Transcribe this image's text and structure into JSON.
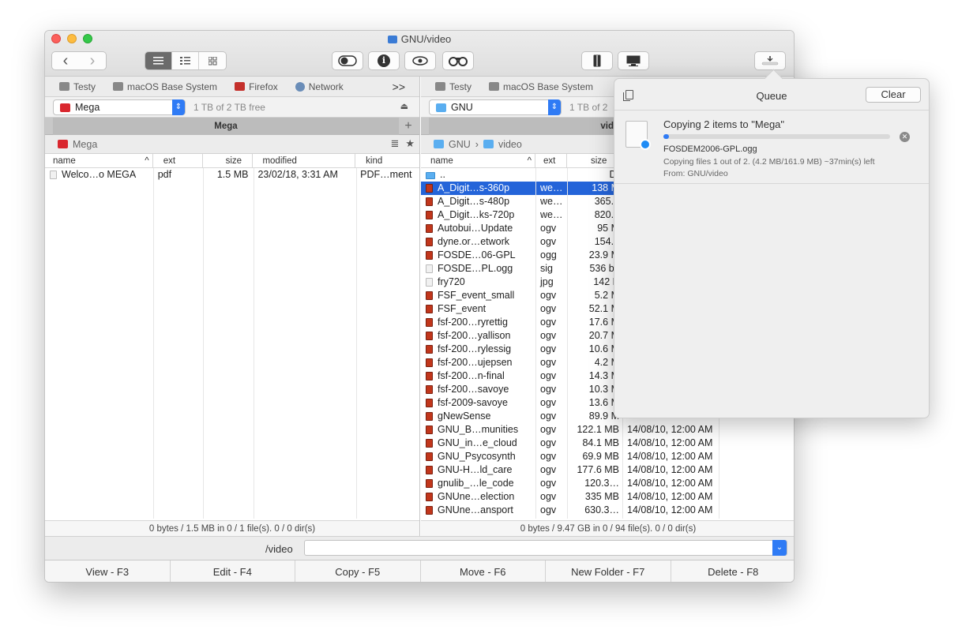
{
  "window": {
    "title": "GNU/video",
    "colors": {
      "selection": "#2464d9",
      "accent": "#2f7bf5"
    }
  },
  "toolbar": {
    "back_icon": "‹",
    "forward_icon": "›",
    "views": [
      "list-view-icon",
      "detail-view-icon",
      "grid-view-icon"
    ],
    "toggle_icon": "toggle-icon",
    "info_icon": "i",
    "preview_icon": "eye-icon",
    "search_icon": "binoculars-icon",
    "archive_icon": "archive-icon",
    "network_icon": "monitor-icon",
    "queue_icon": "download-queue-icon"
  },
  "left": {
    "bookmarks": [
      "Testy",
      "macOS Base System",
      "Firefox",
      "Network"
    ],
    "more": ">>",
    "drive": "Mega",
    "free": "1 TB of 2 TB free",
    "tab": "Mega",
    "path": "Mega",
    "columns": [
      "name",
      "ext",
      "size",
      "modified",
      "kind"
    ],
    "rows": [
      {
        "name": "Welco…o MEGA",
        "ext": "pdf",
        "size": "1.5 MB",
        "modified": "23/02/18, 3:31 AM",
        "kind": "PDF…ment"
      }
    ],
    "status": "0 bytes / 1.5 MB in 0 / 1 file(s). 0 / 0 dir(s)"
  },
  "right": {
    "bookmarks": [
      "Testy",
      "macOS Base System"
    ],
    "drive": "GNU",
    "free": "1 TB of 2",
    "tab": "vid",
    "path_root": "GNU",
    "path_sep": "›",
    "path_leaf": "video",
    "columns": [
      "name",
      "ext",
      "size"
    ],
    "rows": [
      {
        "name": "..",
        "ext": "",
        "size": "DI",
        "modified": "",
        "type": "folder"
      },
      {
        "name": "A_Digit…s-360p",
        "ext": "we…",
        "size": "138 M",
        "modified": "",
        "type": "video",
        "selected": true
      },
      {
        "name": "A_Digit…s-480p",
        "ext": "we…",
        "size": "365.1",
        "modified": "",
        "type": "video"
      },
      {
        "name": "A_Digit…ks-720p",
        "ext": "we…",
        "size": "820.5",
        "modified": "",
        "type": "video"
      },
      {
        "name": "Autobui…Update",
        "ext": "ogv",
        "size": "95 M",
        "modified": "",
        "type": "video"
      },
      {
        "name": "dyne.or…etwork",
        "ext": "ogv",
        "size": "154.8",
        "modified": "",
        "type": "video"
      },
      {
        "name": "FOSDE…06-GPL",
        "ext": "ogg",
        "size": "23.9 M",
        "modified": "",
        "type": "video"
      },
      {
        "name": "FOSDE…PL.ogg",
        "ext": "sig",
        "size": "536 by",
        "modified": "",
        "type": "doc"
      },
      {
        "name": "fry720",
        "ext": "jpg",
        "size": "142 K",
        "modified": "",
        "type": "doc"
      },
      {
        "name": "FSF_event_small",
        "ext": "ogv",
        "size": "5.2 M",
        "modified": "",
        "type": "video"
      },
      {
        "name": "FSF_event",
        "ext": "ogv",
        "size": "52.1 M",
        "modified": "",
        "type": "video"
      },
      {
        "name": "fsf-200…ryrettig",
        "ext": "ogv",
        "size": "17.6 M",
        "modified": "",
        "type": "video"
      },
      {
        "name": "fsf-200…yallison",
        "ext": "ogv",
        "size": "20.7 M",
        "modified": "",
        "type": "video"
      },
      {
        "name": "fsf-200…rylessig",
        "ext": "ogv",
        "size": "10.6 M",
        "modified": "",
        "type": "video"
      },
      {
        "name": "fsf-200…ujepsen",
        "ext": "ogv",
        "size": "4.2 M",
        "modified": "",
        "type": "video"
      },
      {
        "name": "fsf-200…n-final",
        "ext": "ogv",
        "size": "14.3 M",
        "modified": "",
        "type": "video"
      },
      {
        "name": "fsf-200…savoye",
        "ext": "ogv",
        "size": "10.3 M",
        "modified": "",
        "type": "video"
      },
      {
        "name": "fsf-2009-savoye",
        "ext": "ogv",
        "size": "13.6 M",
        "modified": "",
        "type": "video"
      },
      {
        "name": "gNewSense",
        "ext": "ogv",
        "size": "89.9 M",
        "modified": "",
        "type": "video"
      },
      {
        "name": "GNU_B…munities",
        "ext": "ogv",
        "size": "122.1 MB",
        "modified": "14/08/10, 12:00 AM",
        "type": "video"
      },
      {
        "name": "GNU_in…e_cloud",
        "ext": "ogv",
        "size": "84.1 MB",
        "modified": "14/08/10, 12:00 AM",
        "type": "video"
      },
      {
        "name": "GNU_Psycosynth",
        "ext": "ogv",
        "size": "69.9 MB",
        "modified": "14/08/10, 12:00 AM",
        "type": "video"
      },
      {
        "name": "GNU-H…ld_care",
        "ext": "ogv",
        "size": "177.6 MB",
        "modified": "14/08/10, 12:00 AM",
        "type": "video"
      },
      {
        "name": "gnulib_…le_code",
        "ext": "ogv",
        "size": "120.3…",
        "modified": "14/08/10, 12:00 AM",
        "type": "video"
      },
      {
        "name": "GNUne…election",
        "ext": "ogv",
        "size": "335 MB",
        "modified": "14/08/10, 12:00 AM",
        "type": "video"
      },
      {
        "name": "GNUne…ansport",
        "ext": "ogv",
        "size": "630.3…",
        "modified": "14/08/10, 12:00 AM",
        "type": "video"
      }
    ],
    "status": "0 bytes / 9.47 GB in 0 / 94 file(s). 0 / 0 dir(s)"
  },
  "cmdline": {
    "label": "/video",
    "value": ""
  },
  "fkeys": [
    "View - F3",
    "Edit - F4",
    "Copy - F5",
    "Move - F6",
    "New Folder - F7",
    "Delete - F8"
  ],
  "queue": {
    "title": "Queue",
    "clear_label": "Clear",
    "item": {
      "title": "Copying 2 items to \"Mega\"",
      "progress": 0.026,
      "file": "FOSDEM2006-GPL.ogg",
      "info": "Copying files 1 out of 2. (4.2 MB/161.9 MB) ~37min(s) left",
      "from": "From: GNU/video"
    }
  }
}
